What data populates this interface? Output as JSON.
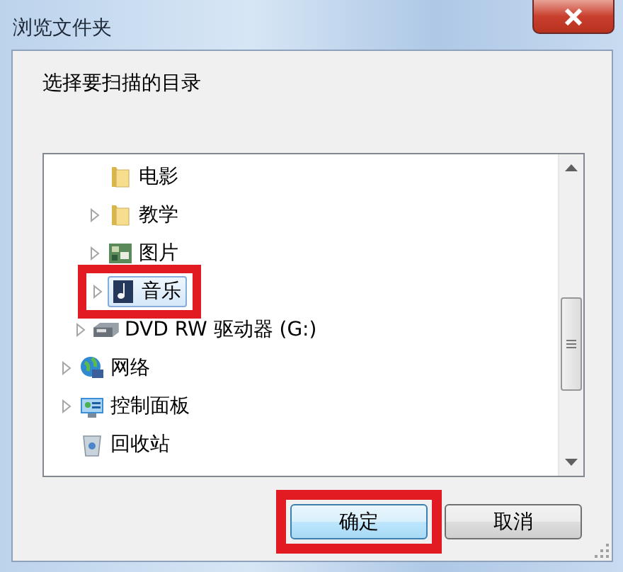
{
  "window": {
    "title": "浏览文件夹"
  },
  "prompt": "选择要扫描的目录",
  "tree": [
    {
      "children": [
        {
          "children": [
            {
              "label": "电影",
              "kind": "folder",
              "expandable": false,
              "selected": false,
              "highlighted": false
            },
            {
              "label": "教学",
              "kind": "folder",
              "expandable": true,
              "selected": false,
              "highlighted": false
            },
            {
              "label": "图片",
              "kind": "pictures",
              "expandable": true,
              "selected": false,
              "highlighted": false
            },
            {
              "label": "音乐",
              "kind": "music",
              "expandable": true,
              "selected": true,
              "highlighted": true
            }
          ]
        },
        {
          "label": "DVD RW 驱动器 (G:)",
          "kind": "dvd",
          "expandable": true,
          "selected": false,
          "highlighted": false
        }
      ]
    },
    {
      "label": "网络",
      "kind": "network",
      "expandable": true,
      "selected": false,
      "highlighted": false
    },
    {
      "label": "控制面板",
      "kind": "control-panel",
      "expandable": true,
      "selected": false,
      "highlighted": false
    },
    {
      "label": "回收站",
      "kind": "recycle-bin",
      "expandable": false,
      "selected": false,
      "highlighted": false
    }
  ],
  "buttons": [
    {
      "label": "确定",
      "highlighted": true
    },
    {
      "label": "取消",
      "highlighted": false
    }
  ]
}
